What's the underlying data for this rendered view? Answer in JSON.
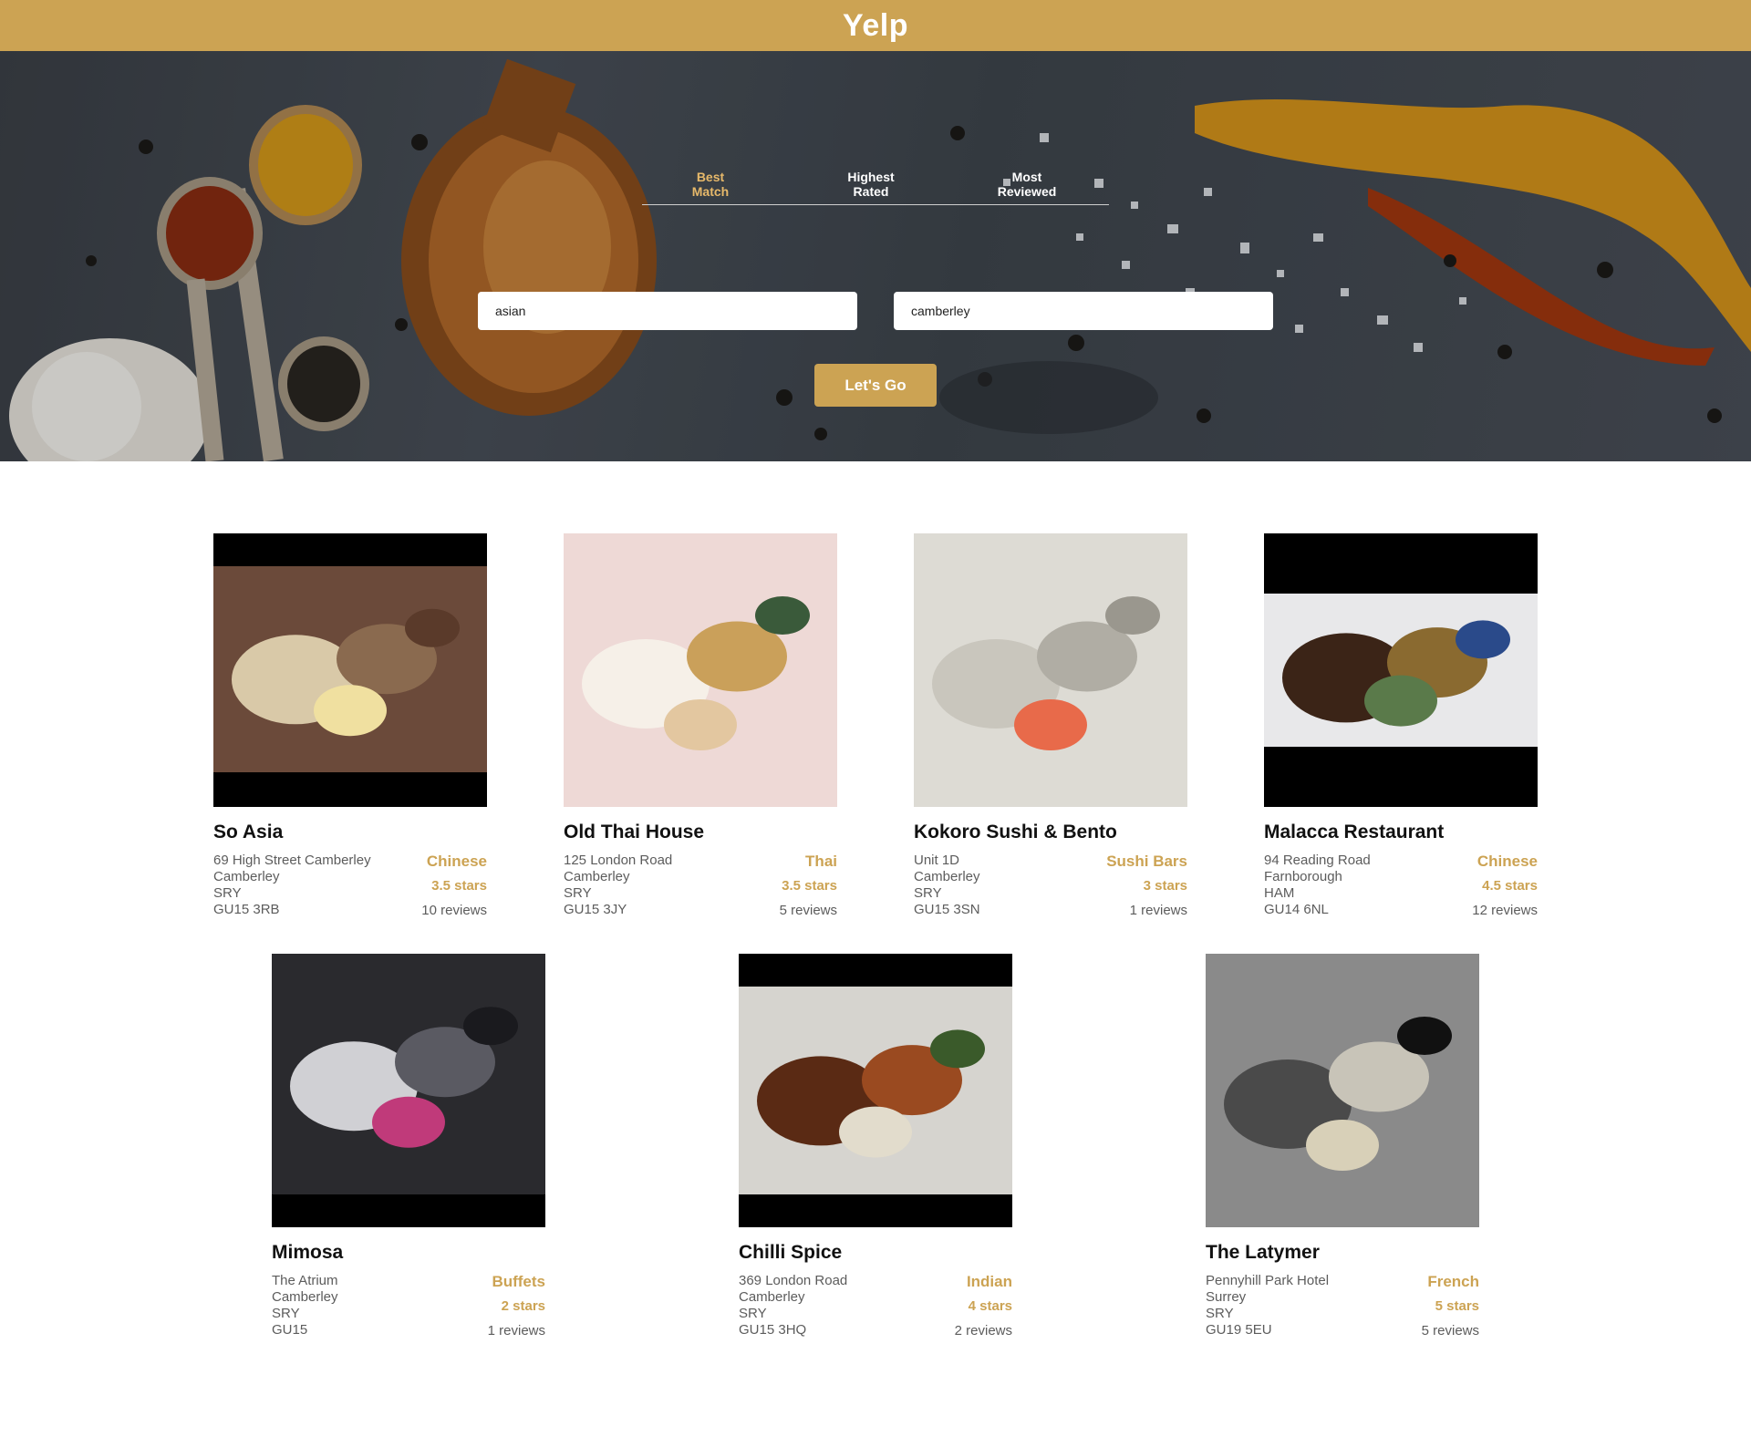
{
  "app": {
    "title": "Yelp"
  },
  "hero": {
    "sort_options": [
      {
        "label": "Best Match",
        "active": true
      },
      {
        "label": "Highest Rated",
        "active": false
      },
      {
        "label": "Most Reviewed",
        "active": false
      }
    ],
    "term_value": "asian",
    "location_value": "camberley",
    "submit_label": "Let's Go"
  },
  "businesses": [
    {
      "name": "So Asia",
      "address": "69 High Street Camberley",
      "city": "Camberley",
      "state": "SRY",
      "zip": "GU15 3RB",
      "category": "Chinese",
      "rating": "3.5 stars",
      "reviews": "10 reviews"
    },
    {
      "name": "Old Thai House",
      "address": "125 London Road",
      "city": "Camberley",
      "state": "SRY",
      "zip": "GU15 3JY",
      "category": "Thai",
      "rating": "3.5 stars",
      "reviews": "5 reviews"
    },
    {
      "name": "Kokoro Sushi & Bento",
      "address": "Unit 1D",
      "city": "Camberley",
      "state": "SRY",
      "zip": "GU15 3SN",
      "category": "Sushi Bars",
      "rating": "3 stars",
      "reviews": "1 reviews"
    },
    {
      "name": "Malacca Restaurant",
      "address": "94 Reading Road",
      "city": "Farnborough",
      "state": "HAM",
      "zip": "GU14 6NL",
      "category": "Chinese",
      "rating": "4.5 stars",
      "reviews": "12 reviews"
    },
    {
      "name": "Mimosa",
      "address": "The Atrium",
      "city": "Camberley",
      "state": "SRY",
      "zip": "GU15",
      "category": "Buffets",
      "rating": "2 stars",
      "reviews": "1 reviews"
    },
    {
      "name": "Chilli Spice",
      "address": "369 London Road",
      "city": "Camberley",
      "state": "SRY",
      "zip": "GU15 3HQ",
      "category": "Indian",
      "rating": "4 stars",
      "reviews": "2 reviews"
    },
    {
      "name": "The Latymer",
      "address": "Pennyhill Park Hotel",
      "city": "Surrey",
      "state": "SRY",
      "zip": "GU19 5EU",
      "category": "French",
      "rating": "5 stars",
      "reviews": "5 reviews"
    }
  ]
}
